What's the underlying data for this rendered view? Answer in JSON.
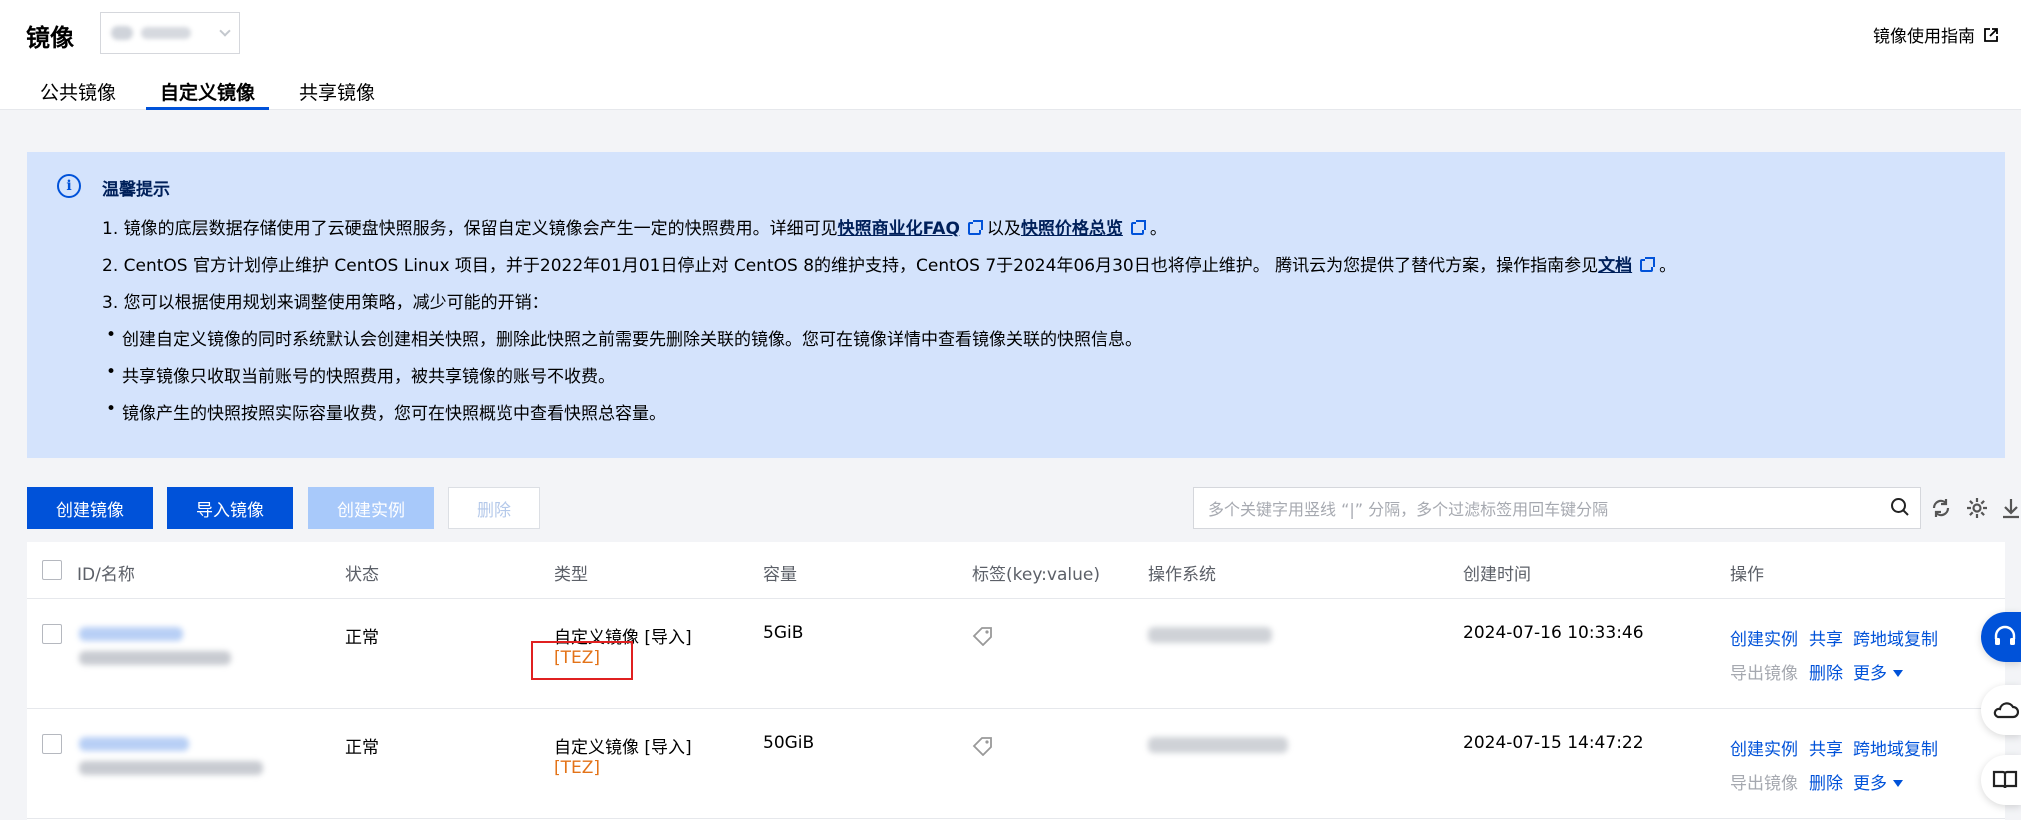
{
  "header": {
    "title": "镜像",
    "guide_label": "镜像使用指南"
  },
  "tabs": [
    {
      "label": "公共镜像",
      "active": false
    },
    {
      "label": "自定义镜像",
      "active": true
    },
    {
      "label": "共享镜像",
      "active": false
    }
  ],
  "notice": {
    "title": "温馨提示",
    "line1_prefix": "1. 镜像的底层数据存储使用了云硬盘快照服务，保留自定义镜像会产生一定的快照费用。详细可见",
    "line1_link1": "快照商业化FAQ",
    "line1_mid": "以及",
    "line1_link2": "快照价格总览",
    "line1_suffix": "。",
    "line2_prefix": "2. CentOS 官方计划停止维护 CentOS Linux 项目，并于2022年01月01日停止对 CentOS 8的维护支持，CentOS 7于2024年06月30日也将停止维护。 腾讯云为您提供了替代方案，操作指南参见",
    "line2_link": "文档",
    "line2_suffix": "。",
    "line3": "3. 您可以根据使用规划来调整使用策略，减少可能的开销：",
    "bullets": [
      "创建自定义镜像的同时系统默认会创建相关快照，删除此快照之前需要先删除关联的镜像。您可在镜像详情中查看镜像关联的快照信息。",
      "共享镜像只收取当前账号的快照费用，被共享镜像的账号不收费。",
      "镜像产生的快照按照实际容量收费，您可在快照概览中查看快照总容量。"
    ]
  },
  "toolbar": {
    "create_image": "创建镜像",
    "import_image": "导入镜像",
    "create_instance": "创建实例",
    "delete": "删除",
    "search_placeholder": "多个关键字用竖线 “|” 分隔，多个过滤标签用回车键分隔"
  },
  "table": {
    "columns": [
      "ID/名称",
      "状态",
      "类型",
      "容量",
      "标签(key:value)",
      "操作系统",
      "创建时间",
      "操作"
    ],
    "rows": [
      {
        "status": "正常",
        "type": "自定义镜像 [导入]",
        "type_tag": "[TEZ]",
        "capacity": "5GiB",
        "created": "2024-07-16 10:33:46",
        "ops": [
          "创建实例",
          "共享",
          "跨地域复制"
        ],
        "ops2": [
          "导出镜像",
          "删除",
          "更多"
        ]
      },
      {
        "status": "正常",
        "type": "自定义镜像 [导入]",
        "type_tag": "[TEZ]",
        "capacity": "50GiB",
        "created": "2024-07-15 14:47:22",
        "ops": [
          "创建实例",
          "共享",
          "跨地域复制"
        ],
        "ops2": [
          "导出镜像",
          "删除",
          "更多"
        ]
      }
    ]
  },
  "colors": {
    "primary": "#0052d9",
    "notice_bg": "#d4e3fc",
    "tag_orange": "#e37318",
    "highlight_red": "#e02020"
  }
}
